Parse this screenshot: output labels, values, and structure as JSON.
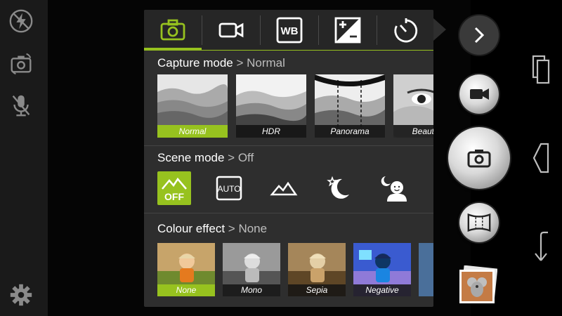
{
  "left_rail": {
    "icons": [
      "flash-off-icon",
      "switch-camera-icon",
      "mic-off-icon",
      "settings-gear-icon"
    ]
  },
  "tabs": [
    {
      "name": "camera-settings",
      "icon": "camera-icon",
      "active": true
    },
    {
      "name": "video-settings",
      "icon": "video-camera-icon",
      "active": false
    },
    {
      "name": "white-balance",
      "label": "WB",
      "icon": "wb-icon",
      "active": false
    },
    {
      "name": "exposure",
      "icon": "exposure-icon",
      "active": false
    },
    {
      "name": "timer",
      "icon": "timer-icon",
      "active": false
    }
  ],
  "capture_mode": {
    "title": "Capture mode",
    "separator": " > ",
    "current": "Normal",
    "options": [
      {
        "label": "Normal",
        "selected": true
      },
      {
        "label": "HDR",
        "selected": false
      },
      {
        "label": "Panorama",
        "selected": false
      },
      {
        "label": "Beautiful",
        "selected": false
      }
    ]
  },
  "scene_mode": {
    "title": "Scene mode",
    "separator": " > ",
    "current": "Off",
    "options": [
      {
        "label": "OFF",
        "icon": "scene-off-icon",
        "selected": true
      },
      {
        "label": "AUTO",
        "icon": "scene-auto-icon",
        "selected": false
      },
      {
        "icon": "landscape-icon",
        "selected": false
      },
      {
        "icon": "night-icon",
        "selected": false
      },
      {
        "icon": "night-portrait-icon",
        "selected": false
      }
    ]
  },
  "colour_effect": {
    "title": "Colour effect",
    "separator": " > ",
    "current": "None",
    "options": [
      {
        "label": "None",
        "selected": true
      },
      {
        "label": "Mono",
        "selected": false
      },
      {
        "label": "Sepia",
        "selected": false
      },
      {
        "label": "Negative",
        "selected": false
      }
    ]
  },
  "right_controls": {
    "icons": [
      "chevron-right-icon",
      "video-record-icon",
      "shutter-camera-icon",
      "panorama-mode-icon",
      "gallery-thumbnail"
    ]
  },
  "nav_bar": {
    "icons": [
      "recent-apps-icon",
      "back-icon",
      "rotate-icon"
    ]
  },
  "colors": {
    "accent": "#97c21f",
    "panel_bg": "#2e2e2e",
    "subtitle": "#bdbdbd"
  }
}
